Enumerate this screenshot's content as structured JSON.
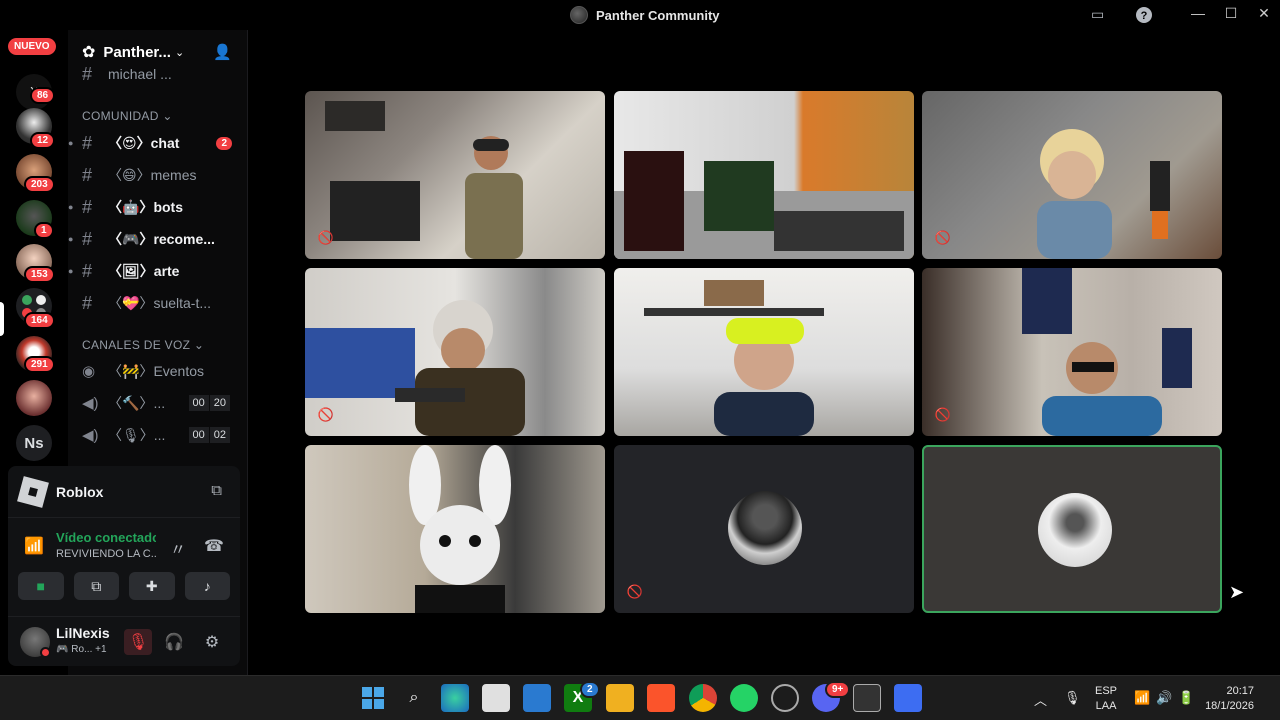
{
  "window": {
    "title": "Panther Community"
  },
  "rail": {
    "new_label": "NUEVO",
    "servers": [
      {
        "name": "server-1",
        "badge": "86"
      },
      {
        "name": "server-2",
        "badge": "12"
      },
      {
        "name": "server-3",
        "badge": "203"
      },
      {
        "name": "server-4",
        "badge": "1"
      },
      {
        "name": "server-5",
        "badge": "153"
      },
      {
        "name": "server-6",
        "badge": "164"
      },
      {
        "name": "server-7",
        "badge": "291"
      },
      {
        "name": "server-8",
        "badge": ""
      },
      {
        "name": "server-ns",
        "label": "Ns"
      }
    ]
  },
  "sidebar": {
    "server_name": "Panther...",
    "partial_channel": "michael ...",
    "community_category": "COMUNIDAD",
    "text_channels": [
      {
        "emoji": "〈😍〉",
        "name": "chat",
        "badge": "2",
        "unread": true
      },
      {
        "emoji": "〈😄〉",
        "name": "memes",
        "badge": "",
        "unread": false
      },
      {
        "emoji": "〈🤖〉",
        "name": "bots",
        "badge": "",
        "unread": true
      },
      {
        "emoji": "〈🎮〉",
        "name": "recome...",
        "badge": "",
        "unread": true
      },
      {
        "emoji": "〈🖼〉",
        "name": "arte",
        "badge": "",
        "unread": true
      },
      {
        "emoji": "〈💝〉",
        "name": "suelta-t...",
        "badge": "",
        "unread": false
      }
    ],
    "voice_category": "CANALES DE VOZ",
    "voice_channels": [
      {
        "emoji": "〈🚧〉",
        "name": "Eventos",
        "count_a": "",
        "count_b": ""
      },
      {
        "emoji": "〈🔨〉",
        "name": "...",
        "count_a": "00",
        "count_b": "20"
      },
      {
        "emoji": "〈🎙〉",
        "name": "...",
        "count_a": "00",
        "count_b": "02"
      }
    ]
  },
  "voice_panel": {
    "activity": "Roblox",
    "connection_title": "Vídeo conectado",
    "connection_sub": "REVIVIENDO LA C...",
    "user_name": "LilNexis",
    "user_sub": "Ro...",
    "user_sub_extra": "+1"
  },
  "taskbar": {
    "lang_top": "ESP",
    "lang_bottom": "LAA",
    "time": "20:17",
    "date": "18/1/2026",
    "xbox_badge": "2",
    "discord_badge": "9+"
  },
  "colors": {
    "accent_green": "#23a55a",
    "badge_red": "#f23f42",
    "speaking_border": "#3ba55d"
  }
}
